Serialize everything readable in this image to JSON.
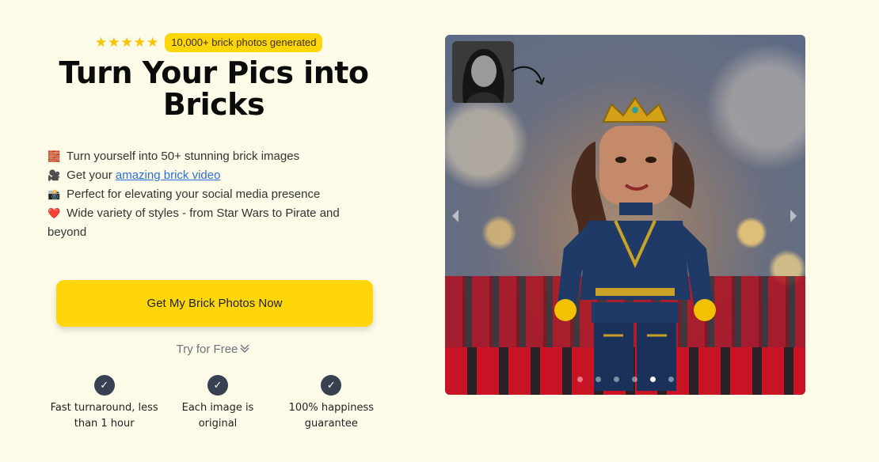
{
  "hero": {
    "rating_stars": "★★★★★",
    "badge": "10,000+ brick photos generated",
    "title": "Turn Your Pics into Bricks"
  },
  "features": [
    {
      "emoji": "🧱",
      "text": "Turn yourself into 50+ stunning brick images"
    },
    {
      "emoji": "🎥",
      "prefix": "Get your ",
      "link": "amazing brick video"
    },
    {
      "emoji": "📸",
      "text": "Perfect for elevating your social media presence"
    },
    {
      "emoji": "❤️",
      "text": "Wide variety of styles - from Star Wars to Pirate and beyond"
    }
  ],
  "cta": {
    "label": "Get My Brick Photos Now",
    "secondary": "Try for Free"
  },
  "guarantees": [
    {
      "line1": "Fast turnaround, less",
      "line2": "than 1 hour"
    },
    {
      "line1": "Each image is",
      "line2": "original"
    },
    {
      "line1": "100% happiness",
      "line2": "guarantee"
    }
  ],
  "carousel": {
    "prev": "‹",
    "next": "›",
    "dot_count": 6,
    "active_dot": 4
  },
  "colors": {
    "background": "#fefbe8",
    "accent": "#ffd60a",
    "link": "#2a6fdb",
    "check": "#374151"
  }
}
